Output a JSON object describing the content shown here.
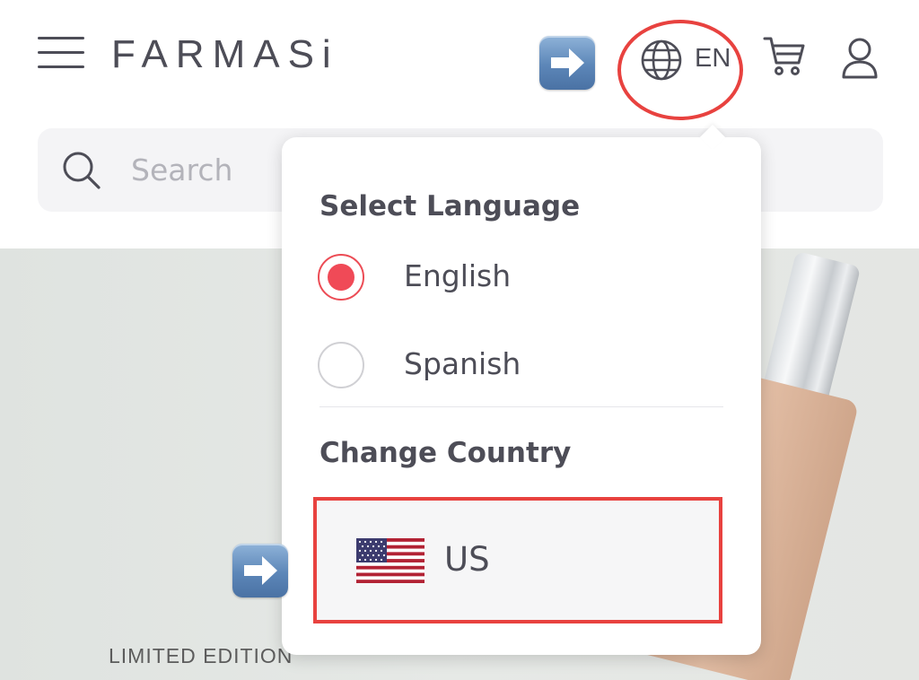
{
  "header": {
    "brand": "FARMASi",
    "language_code": "EN"
  },
  "search": {
    "placeholder": "Search"
  },
  "language_menu": {
    "title": "Select Language",
    "options": [
      {
        "label": "English",
        "selected": true
      },
      {
        "label": "Spanish",
        "selected": false
      }
    ],
    "country_title": "Change Country",
    "country": {
      "label": "US",
      "flag": "us-flag"
    }
  },
  "banner": {
    "caption": "LIMITED EDITION"
  },
  "annotations": {
    "highlight_color": "#e8423f",
    "arrow_icon": "right-arrow-emoji"
  },
  "colors": {
    "text": "#4d4d57",
    "radio_accent": "#f04a57",
    "search_bg": "#f4f4f6"
  }
}
